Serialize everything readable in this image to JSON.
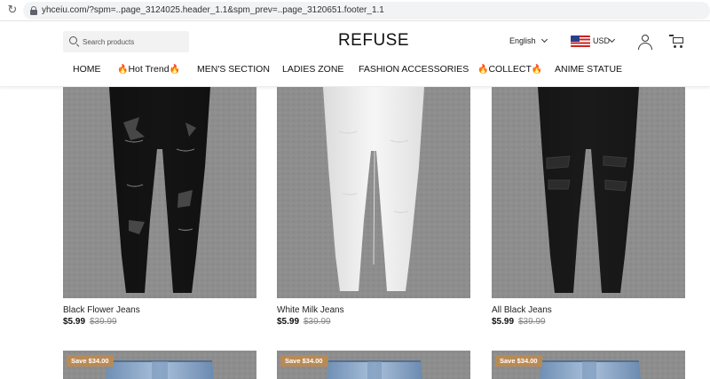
{
  "browser": {
    "url": "yhceiu.com/?spm=..page_3124025.header_1.1&spm_prev=..page_3120651.footer_1.1"
  },
  "header": {
    "search_placeholder": "Search products",
    "logo": "REFUSE",
    "language": "English",
    "currency": "USD"
  },
  "nav": {
    "items": [
      {
        "label": "HOME",
        "fire": false
      },
      {
        "label": "Hot Trend",
        "fire": true
      },
      {
        "label": "MEN'S SECTION",
        "fire": false
      },
      {
        "label": "LADIES ZONE",
        "fire": false
      },
      {
        "label": "FASHION ACCESSORIES",
        "fire": false
      },
      {
        "label": "COLLECT",
        "fire": true
      },
      {
        "label": "ANIME STATUE",
        "fire": false
      }
    ],
    "fire_glyph": "🔥"
  },
  "products": [
    {
      "title": "Black Flower Jeans",
      "price": "$5.99",
      "compare_price": "$39.99",
      "color": "black",
      "distressed": true
    },
    {
      "title": "White Milk Jeans",
      "price": "$5.99",
      "compare_price": "$39.99",
      "color": "white",
      "distressed": true
    },
    {
      "title": "All Black Jeans",
      "price": "$5.99",
      "compare_price": "$39.99",
      "color": "black",
      "distressed": true
    }
  ],
  "products_row2": [
    {
      "badge": "Save $34.00",
      "color": "light-blue"
    },
    {
      "badge": "Save $34.00",
      "color": "light-blue"
    },
    {
      "badge": "Save $34.00",
      "color": "light-blue"
    }
  ],
  "colors": {
    "photo_background": "#8e8e8e",
    "badge": "#b98a55",
    "accent_fire": "#e8731a"
  }
}
